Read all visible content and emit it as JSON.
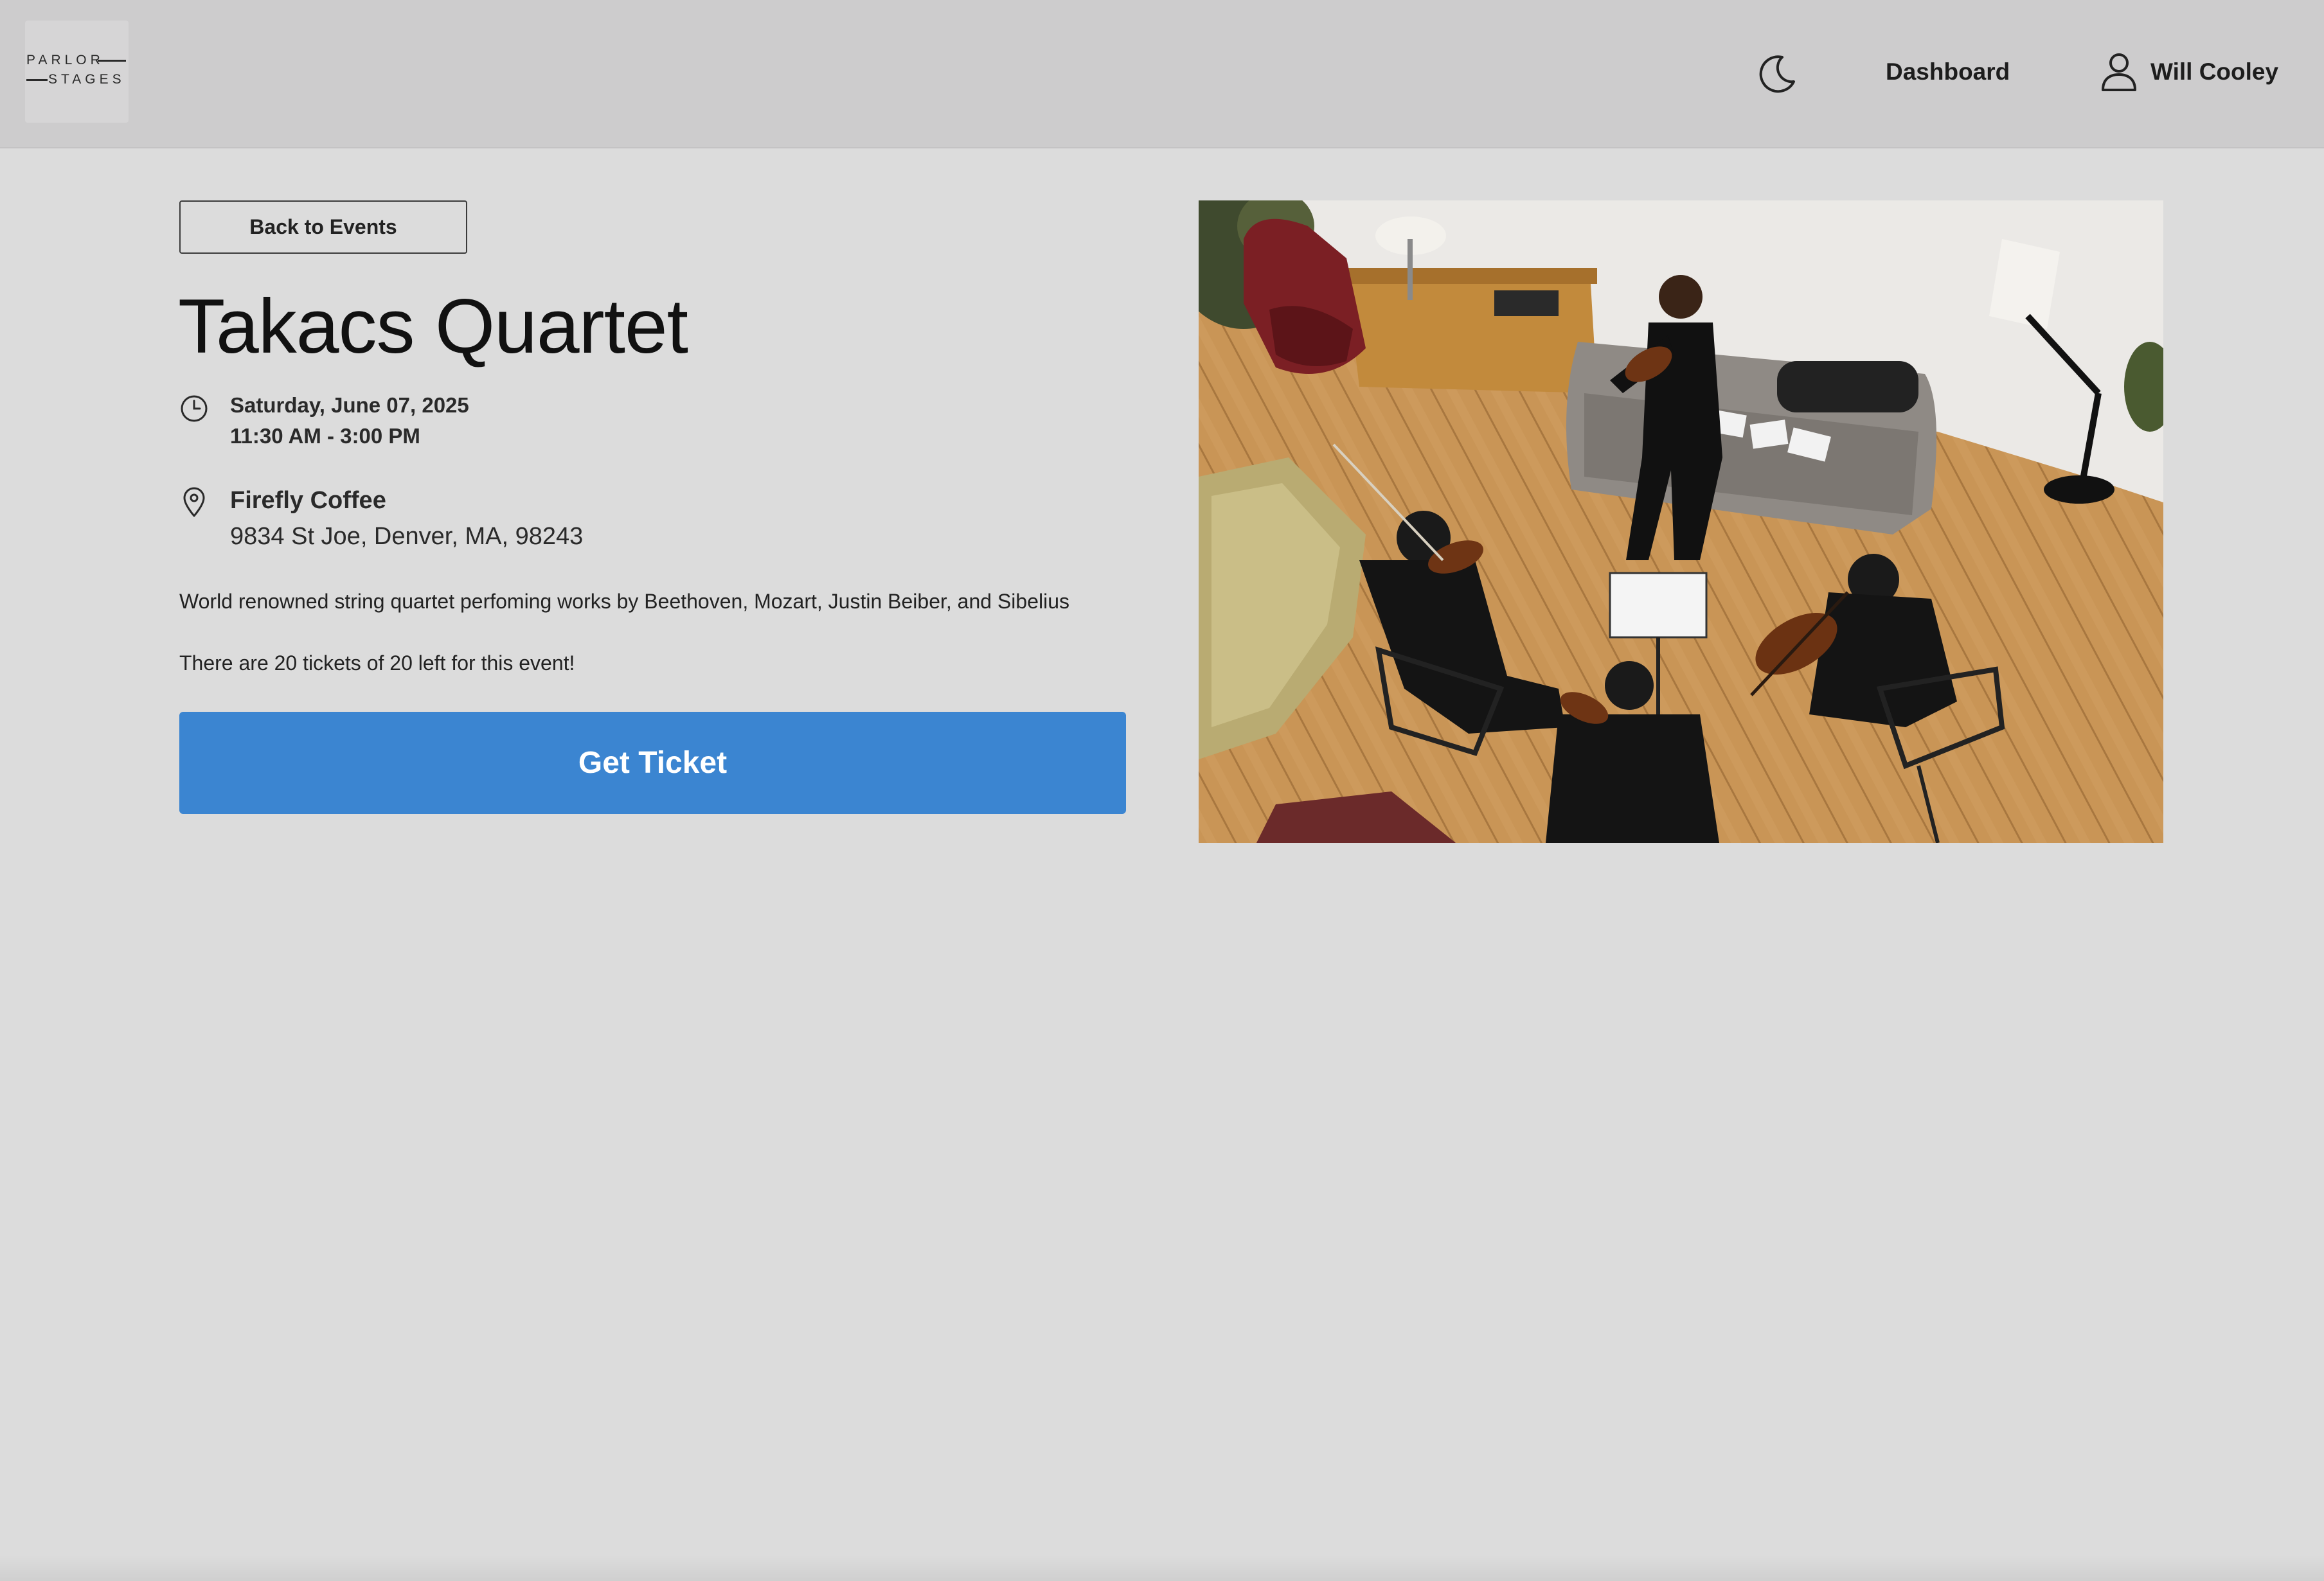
{
  "header": {
    "logo": {
      "line1": "PARLOR",
      "line2": "STAGES"
    },
    "theme_toggle_icon": "moon-icon",
    "nav": {
      "dashboard_label": "Dashboard"
    },
    "user": {
      "icon": "user-icon",
      "name": "Will Cooley"
    }
  },
  "event": {
    "back_label": "Back to Events",
    "title": "Takacs Quartet",
    "time_icon": "clock-icon",
    "date": "Saturday, June 07, 2025",
    "time": "11:30 AM - 3:00 PM",
    "location_icon": "map-pin-icon",
    "venue": "Firefly Coffee",
    "address": "9834 St Joe, Denver, MA, 98243",
    "description": "World renowned string quartet perfoming works by Beethoven, Mozart, Justin Beiber, and Sibelius",
    "tickets_left": "There are 20 tickets of 20 left for this event!",
    "cta_label": "Get Ticket"
  },
  "colors": {
    "header_bg": "#cdcccd",
    "page_bg": "#dcdcdc",
    "cta_bg": "#3b85d1",
    "cta_text": "#ffffff"
  }
}
